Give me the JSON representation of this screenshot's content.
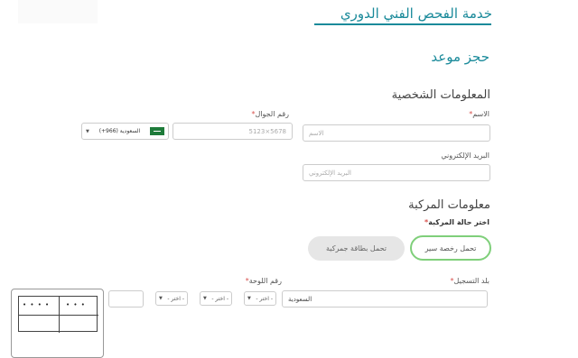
{
  "page": {
    "title": "خدمة الفحص الفني الدوري",
    "booking_heading": "حجز موعد"
  },
  "personal": {
    "heading": "المعلومات الشخصية",
    "name_label": "الاسم",
    "name_placeholder": "الاسم",
    "mobile_label": "رقم الجوال",
    "mobile_placeholder": "5123×5678",
    "country_value": "(+966) السعودية",
    "email_label": "البريد الإلكتروني",
    "email_placeholder": "البريد الإلكتروني",
    "required_mark": "*"
  },
  "vehicle": {
    "heading": "معلومات المركبة",
    "status_label": "اختر حالة المركبة",
    "options": [
      "تحمل رخصة سير",
      "تحمل بطاقة جمركية"
    ],
    "registration_country_label": "بلد التسجيل",
    "registration_country_value": "السعودية",
    "plate_label": "رقم اللوحة",
    "select_placeholder": "- اختر -",
    "plate_dots_left": "• • • •",
    "plate_dots_right": "• • •"
  },
  "icons": {
    "dropdown": "chevron-down-icon",
    "flag": "saudi-flag-icon"
  },
  "colors": {
    "accent": "#1a8a9a",
    "required": "#d9534f",
    "active_border": "#7fcf7a"
  }
}
